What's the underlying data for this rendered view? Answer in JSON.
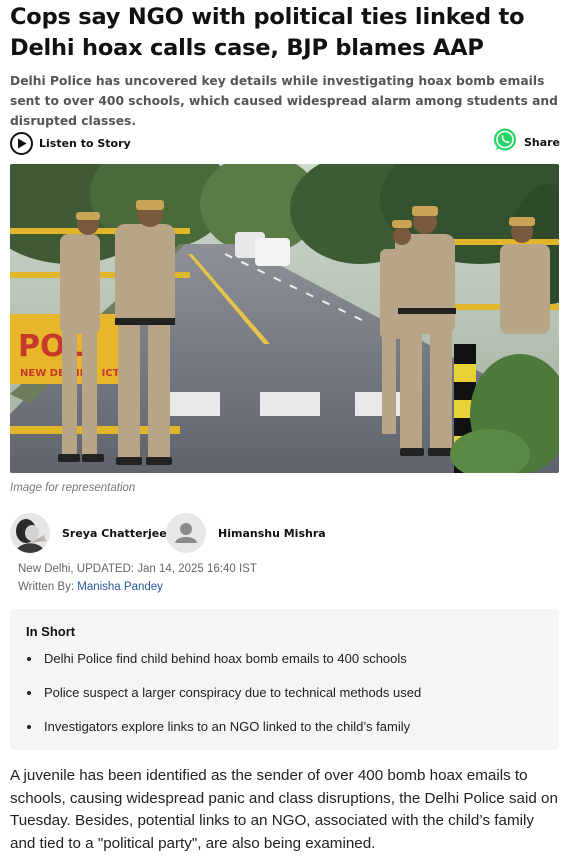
{
  "article": {
    "headline": "Cops say NGO with political ties linked to Delhi hoax calls case, BJP blames AAP",
    "summary": "Delhi Police has uncovered key details while investigating hoax bomb emails sent to over 400 schools, which caused widespread alarm among students and disrupted classes.",
    "image_caption": "Image for representation",
    "body": "A juvenile has been identified as the sender of over 400 bomb hoax emails to schools, causing widespread panic and class disruptions, the Delhi Police said on Tuesday. Besides, potential links to an NGO, associated with the child’s family and tied to a \"political party\", are also being examined."
  },
  "toolbar": {
    "listen_label": "Listen to Story",
    "listen_icon": "play-icon",
    "share_label": "Share",
    "share_icon": "whatsapp-icon",
    "share_color": "#25D366"
  },
  "hero_scene": {
    "barricade_sign_text": "POL",
    "barricade_sign_subtext": "NEW DELHI ... ICT"
  },
  "authors": [
    {
      "name": "Sreya Chatterjee",
      "avatar": "photo-avatar"
    },
    {
      "name": "Himanshu Mishra",
      "avatar": "placeholder-avatar"
    }
  ],
  "meta": {
    "dateline": "New Delhi, UPDATED: Jan 14, 2025 16:40 IST",
    "written_by_prefix": "Written By:",
    "written_by_name": "Manisha Pandey"
  },
  "in_short": {
    "title": "In Short",
    "points": [
      "Delhi Police find child behind hoax bomb emails to 400 schools",
      "Police suspect a larger conspiracy due to technical methods used",
      "Investigators explore links to an NGO linked to the child’s family"
    ]
  }
}
